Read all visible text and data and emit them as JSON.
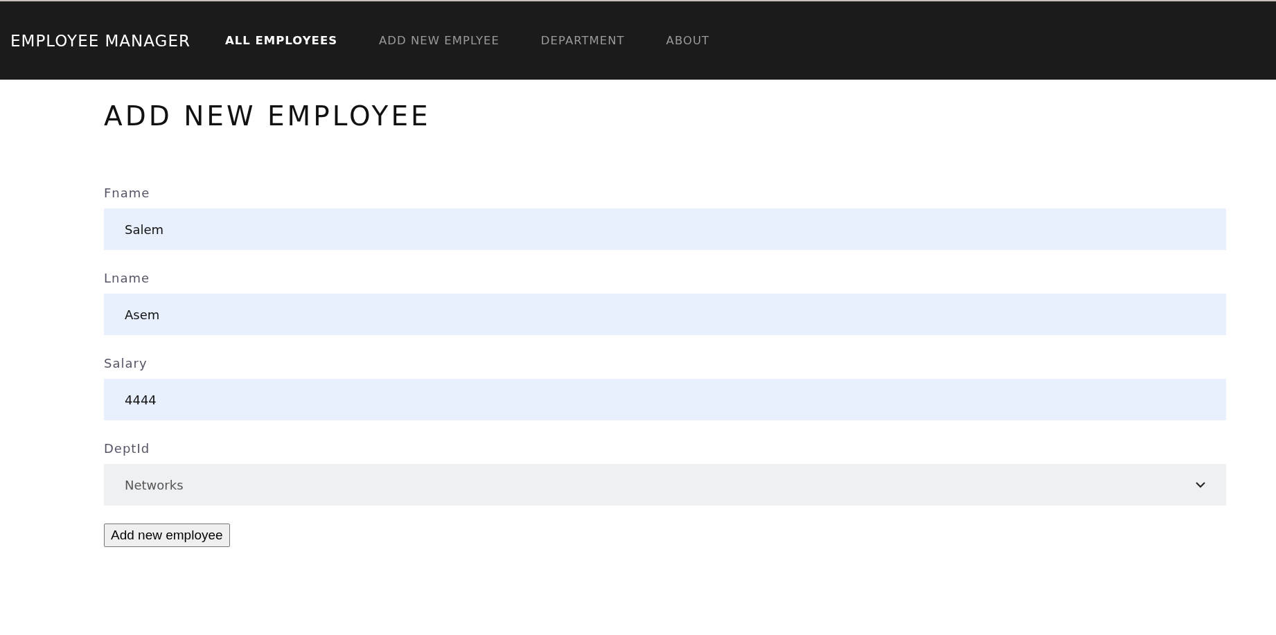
{
  "navbar": {
    "brand": "EMPLOYEE MANAGER",
    "links": [
      {
        "label": "ALL EMPLOYEES",
        "selected": true
      },
      {
        "label": "ADD NEW EMPLYEE",
        "selected": false
      },
      {
        "label": "DEPARTMENT",
        "selected": false
      },
      {
        "label": "ABOUT",
        "selected": false
      }
    ]
  },
  "page_title": "ADD NEW EMPLOYEE",
  "form": {
    "fields": [
      {
        "kind": "input",
        "label": "Fname",
        "value": "Salem"
      },
      {
        "kind": "input",
        "label": "Lname",
        "value": "Asem"
      },
      {
        "kind": "input",
        "label": "Salary",
        "value": "4444"
      },
      {
        "kind": "select",
        "label": "DeptId",
        "value": "Networks"
      }
    ],
    "submit_button": "Add new employee"
  }
}
